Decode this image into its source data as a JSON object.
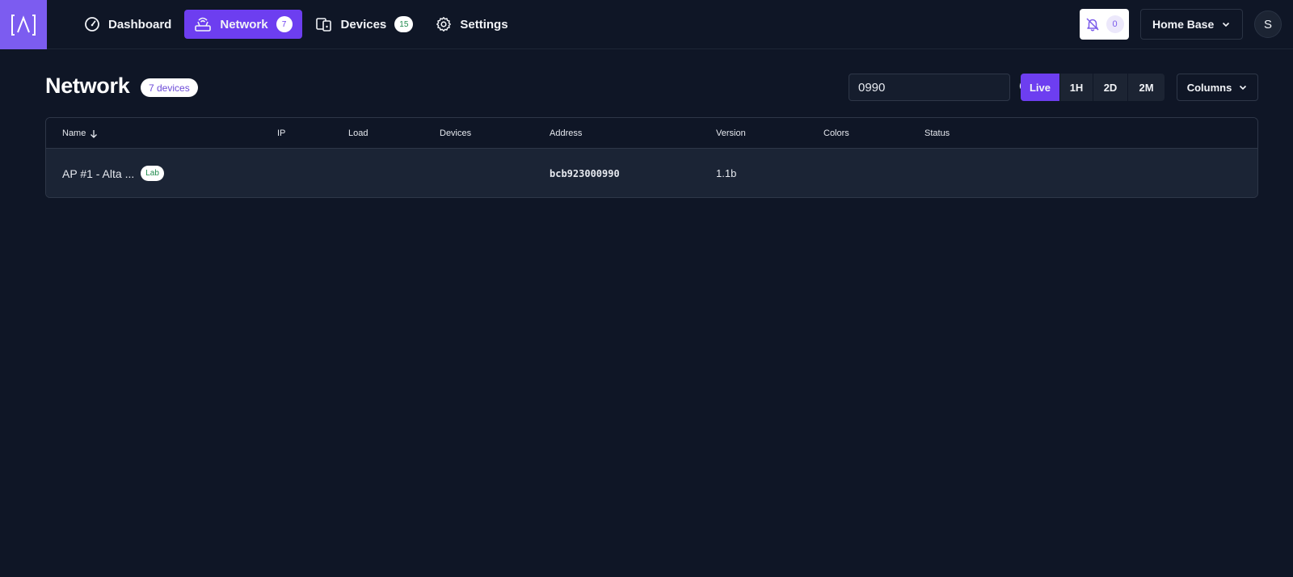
{
  "nav": {
    "items": [
      {
        "label": "Dashboard",
        "icon": "gauge-icon"
      },
      {
        "label": "Network",
        "icon": "router-icon",
        "badge": "7",
        "active": true
      },
      {
        "label": "Devices",
        "icon": "devices-icon",
        "badge": "15"
      },
      {
        "label": "Settings",
        "icon": "gear-icon"
      }
    ]
  },
  "header": {
    "notifications_count": "0",
    "site_name": "Home Base",
    "avatar_initial": "S"
  },
  "page": {
    "title": "Network",
    "device_count": "7 devices"
  },
  "search": {
    "value": "0990"
  },
  "range": {
    "options": [
      "Live",
      "1H",
      "2D",
      "2M"
    ],
    "active": "Live"
  },
  "columns_button": "Columns",
  "table": {
    "headers": [
      "Name",
      "IP",
      "Load",
      "Devices",
      "Address",
      "Version",
      "Colors",
      "Status"
    ],
    "rows": [
      {
        "name": "AP #1 - Alta ...",
        "tag": "Lab",
        "ip": "",
        "load": "",
        "devices": "",
        "address": "bcb923000990",
        "version": "1.1b",
        "colors": "",
        "status": ""
      }
    ]
  },
  "colors": {
    "background": "#0f1626",
    "accent": "#6d3ef0",
    "logo": "#7c5cf0",
    "row": "#1b2435",
    "border": "#2e3748"
  }
}
